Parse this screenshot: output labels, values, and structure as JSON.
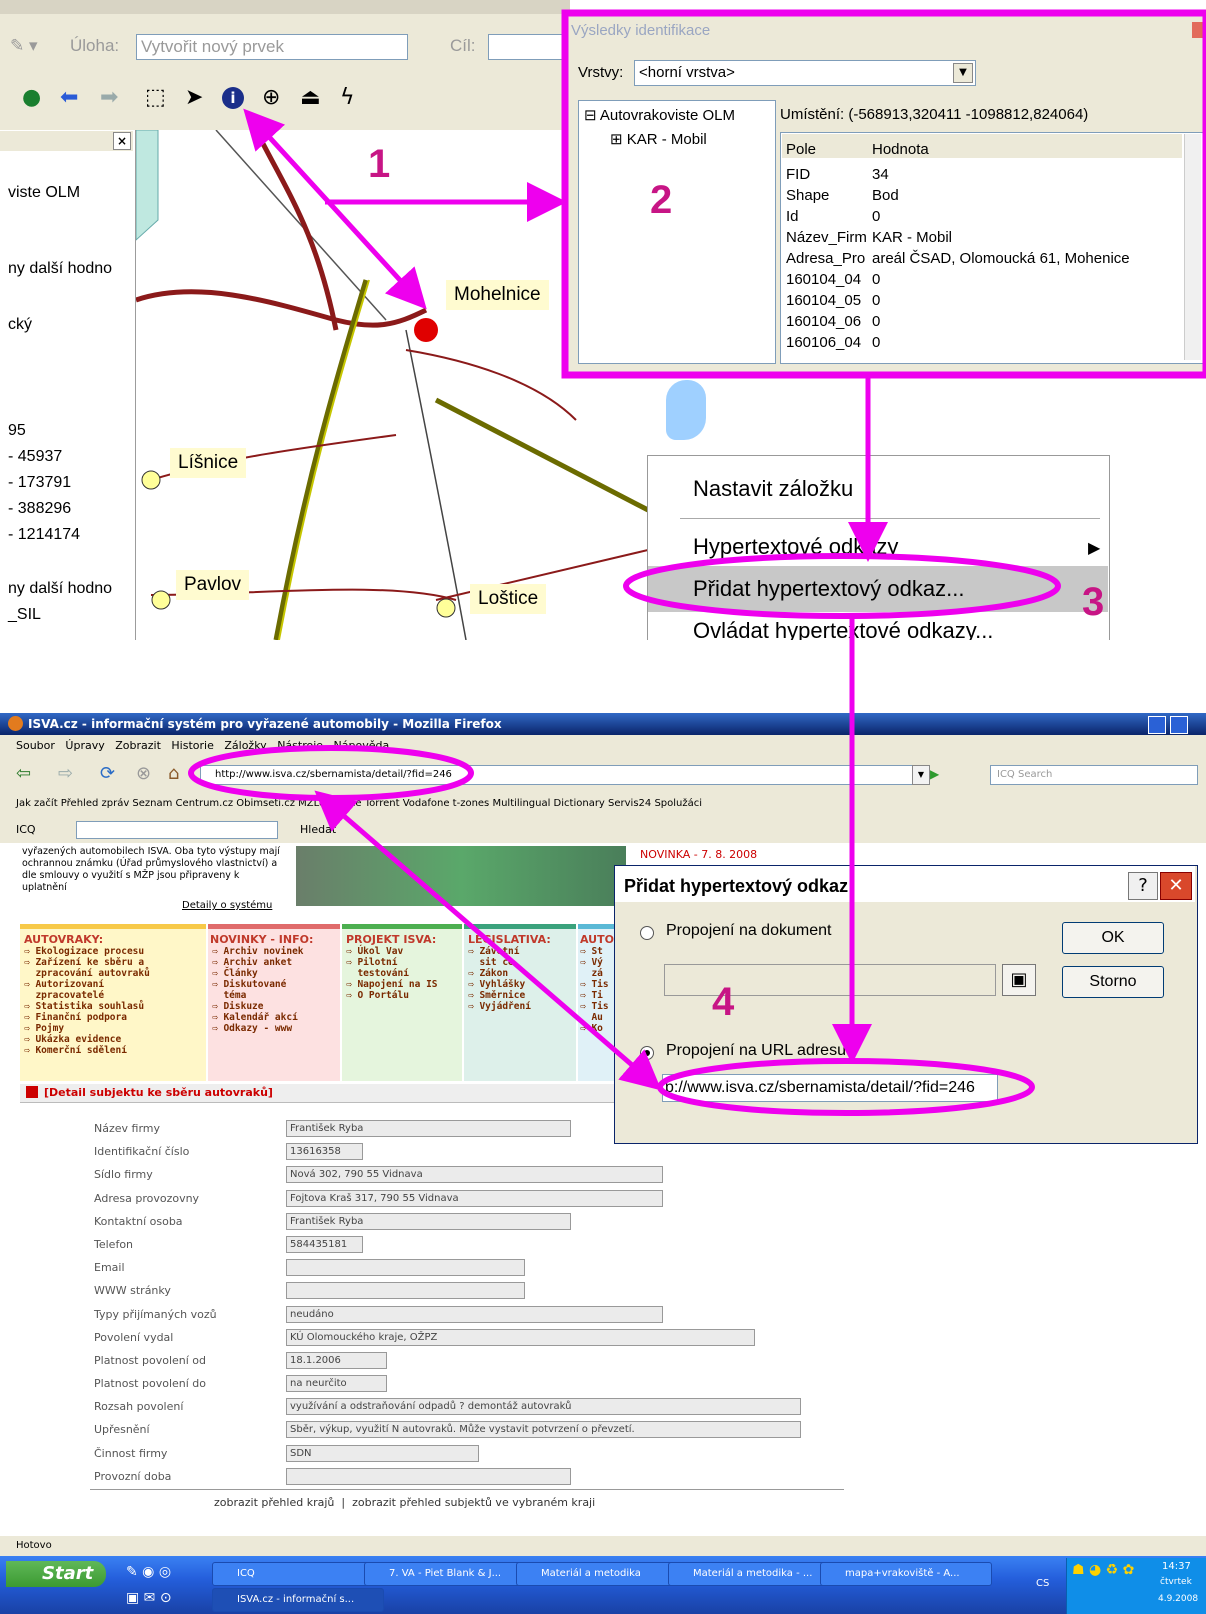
{
  "gis": {
    "task_label": "Úloha:",
    "task_value": "Vytvořit nový prvek",
    "target_label": "Cíl:",
    "left_panel_lines": [
      "viste OLM",
      "ny další hodno",
      "cký",
      "95",
      "- 45937",
      "- 173791",
      "- 388296",
      "- 1214174",
      "ny další hodno",
      "_SIL"
    ],
    "places": {
      "mohelnice": "Mohelnice",
      "lisnice": "Líšnice",
      "pavlov": "Pavlov",
      "lostice": "Loštice"
    }
  },
  "identify": {
    "title": "Výsledky identifikace",
    "layers_label": "Vrstvy:",
    "layers_value": "<horní vrstva>",
    "tree_root": "Autovrakoviste OLM",
    "tree_child": "KAR - Mobil",
    "location": "Umístění: (-568913,320411 -1098812,824064)",
    "col_field": "Pole",
    "col_value": "Hodnota",
    "rows": [
      {
        "field": "FID",
        "value": "34"
      },
      {
        "field": "Shape",
        "value": "Bod"
      },
      {
        "field": "Id",
        "value": "0"
      },
      {
        "field": "Název_Firm",
        "value": "KAR - Mobil"
      },
      {
        "field": "Adresa_Pro",
        "value": "areál ČSAD, Olomoucká 61, Mohenice"
      },
      {
        "field": "160104_04",
        "value": "0"
      },
      {
        "field": "160104_05",
        "value": "0"
      },
      {
        "field": "160104_06",
        "value": "0"
      },
      {
        "field": "160106_04",
        "value": "0"
      }
    ]
  },
  "context_menu": {
    "item1": "Nastavit záložku",
    "item2": "Hypertextové odkazy",
    "item3": "Přidat hypertextový odkaz...",
    "item4": "Ovládat hypertextové odkazy..."
  },
  "steps": {
    "s1": "1",
    "s2": "2",
    "s3": "3",
    "s4": "4"
  },
  "browser": {
    "title": "ISVA.cz - informační systém pro vyřazené automobily - Mozilla Firefox",
    "menu": [
      "Soubor",
      "Úpravy",
      "Zobrazit",
      "Historie",
      "Záložky",
      "Nástroje",
      "Nápověda"
    ],
    "url": "http://www.isva.cz/sbernamista/detail/?fid=246",
    "search_placeholder": "ICQ Search",
    "bookmarks": "Jak začít   Přehled zpráv   Seznam   Centrum.cz   Obimseti.cz   MZLU v Brně   Torrent   Vodafone   t-zones   Multilingual Dictionary   Servis24   Spolužáci",
    "icq": "ICQ",
    "hledat": "Hledat",
    "intro_text": "vyřazených automobilech ISVA. Oba tyto výstupy mají ochrannou známku (Úřad průmyslového vlastnictví) a dle smlouvy o využití s MŽP jsou připraveny k uplatnění",
    "details_link": "Detaily o systému",
    "news": "NOVINKA - 7. 8. 2008",
    "cat1_title": "AUTOVRAKY:",
    "cat1_items": "⇨ Ekologizace procesu\n⇨ Zařízení ke sběru a\n  zpracování autovraků\n⇨ Autorizovaní\n  zpracovatelé\n⇨ Statistika souhlasů\n⇨ Finanční podpora\n⇨ Pojmy\n⇨ Ukázka evidence\n⇨ Komerční sdělení",
    "cat2_title": "NOVINKY - INFO:",
    "cat2_items": "⇨ Archiv novinek\n⇨ Archiv anket\n⇨ Články\n⇨ Diskutované\n  téma\n⇨ Diskuze\n⇨ Kalendář akcí\n⇨ Odkazy - www",
    "cat3_title": "PROJEKT ISVA:",
    "cat3_items": "⇨ Úkol Vav\n⇨ Pilotní\n  testování\n⇨ Napojení na IS\n⇨ O Portálu",
    "cat4_title": "LEGISLATIVA:",
    "cat4_items": "⇨ Závotní\n  sit ce\n⇨ Zákon\n⇨ Vyhlášky\n⇨ Směrnice\n⇨ Vyjádření",
    "cat5_title": "AUTO",
    "cat5_items": "⇨ St\n⇨ Vý\n  zá\n⇨ Tis\n⇨ Ti\n⇨ Tis\n  Au\n⇨ Ko",
    "detail_header": "[Detail subjektu ke sběru autovraků]",
    "form": [
      {
        "label": "Název firmy",
        "value": "František Ryba"
      },
      {
        "label": "Identifikační číslo",
        "value": "13616358"
      },
      {
        "label": "Sídlo firmy",
        "value": "Nová 302, 790 55 Vidnava"
      },
      {
        "label": "Adresa provozovny",
        "value": "Fojtova Kraš 317, 790 55 Vidnava"
      },
      {
        "label": "Kontaktní osoba",
        "value": "František Ryba"
      },
      {
        "label": "Telefon",
        "value": "584435181"
      },
      {
        "label": "Email",
        "value": ""
      },
      {
        "label": "WWW stránky",
        "value": ""
      },
      {
        "label": "Typy přijímaných vozů",
        "value": "neudáno"
      },
      {
        "label": "Povolení vydal",
        "value": "KÚ Olomouckého kraje, OŽPZ"
      },
      {
        "label": "Platnost povolení od",
        "value": "18.1.2006"
      },
      {
        "label": "Platnost povolení do",
        "value": "na neurčito"
      },
      {
        "label": "Rozsah povolení",
        "value": "využívání a odstraňování odpadů ? demontáž autovraků"
      },
      {
        "label": "Upřesnění",
        "value": "Sběr, výkup, využití N autovraků. Může vystavit potvrzení o převzetí."
      },
      {
        "label": "Činnost firmy",
        "value": "SDN"
      },
      {
        "label": "Provozní doba",
        "value": ""
      }
    ],
    "footer_link1": "zobrazit přehled krajů",
    "footer_sep": "|",
    "footer_link2": "zobrazit přehled subjektů ve vybraném kraji",
    "status": "Hotovo"
  },
  "dialog": {
    "title": "Přidat hypertextový odkaz",
    "help": "?",
    "close": "✕",
    "opt1": "Propojení na dokument",
    "opt2": "Propojení na URL adresu",
    "url_value": "p://www.isva.cz/sbernamista/detail/?fid=246",
    "ok": "OK",
    "cancel": "Storno"
  },
  "taskbar": {
    "start": "Start",
    "tasks": [
      "ICQ",
      "7. VA - Piet Blank & J...",
      "Materiál a metodika",
      "Materiál a metodika - ...",
      "mapa+vrakoviště - A...",
      "ISVA.cz - informační s..."
    ],
    "lang": "CS",
    "time": "14:37",
    "day": "čtvrtek",
    "date": "4.9.2008"
  }
}
